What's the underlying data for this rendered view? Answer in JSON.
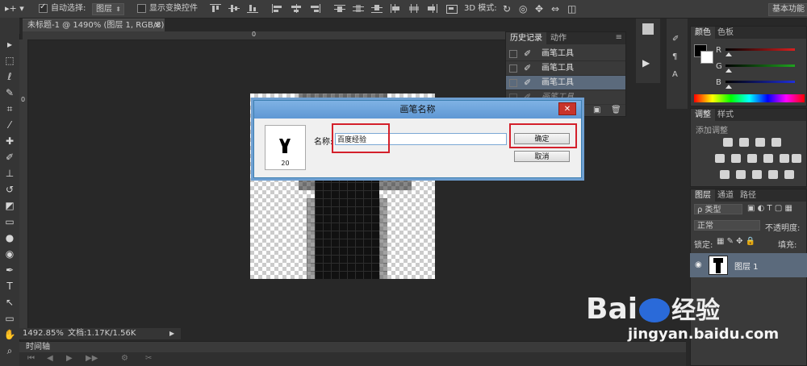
{
  "options_bar": {
    "auto_select_label": "自动选择:",
    "auto_select_value": "图层",
    "show_transform_label": "显示变换控件",
    "mode_3d_label": "3D 模式:",
    "workspace_label": "基本功能"
  },
  "document": {
    "tab_title": "未标题-1 @ 1490% (图层 1, RGB/8) *",
    "ruler_zero_h": "0",
    "ruler_zero_v": "0",
    "zoom": "1492.85%",
    "doc_size": "文档:1.17K/1.56K"
  },
  "timeline": {
    "label": "时间轴"
  },
  "history_panel": {
    "tabs": [
      "历史记录",
      "动作"
    ],
    "rows": [
      {
        "label": "画笔工具"
      },
      {
        "label": "画笔工具"
      },
      {
        "label": "画笔工具"
      },
      {
        "label": "画笔工具"
      }
    ]
  },
  "dialog": {
    "title": "画笔名称",
    "close_label": "✕",
    "brush_size": "20",
    "name_label": "名称:",
    "name_value": "百度经验",
    "ok_label": "确定",
    "cancel_label": "取消"
  },
  "color_panel": {
    "tabs": [
      "颜色",
      "色板"
    ],
    "r_label": "R",
    "g_label": "G",
    "b_label": "B",
    "colors": {
      "red": "#d91f1f",
      "green": "#1fa31f",
      "blue": "#1f2fd9"
    }
  },
  "adjust_panel": {
    "tabs": [
      "调整",
      "样式"
    ],
    "add_label": "添加调整"
  },
  "layers_panel": {
    "tabs": [
      "图层",
      "通道",
      "路径"
    ],
    "filter_label": "ρ 类型",
    "blend_mode": "正常",
    "opacity_label": "不透明度:",
    "lock_label": "锁定:",
    "fill_label": "填充:",
    "layer_name": "图层 1"
  },
  "watermark": {
    "brand": "Bai",
    "brand2": "经验",
    "url": "jingyan.baidu.com"
  }
}
